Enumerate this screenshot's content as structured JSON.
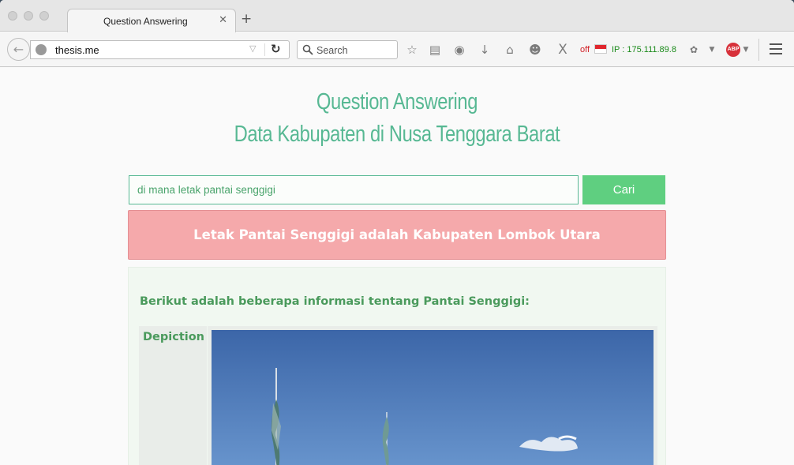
{
  "browser": {
    "tab_title": "Question Answering",
    "tab_close": "✕",
    "new_tab": "+",
    "url": "thesis.me",
    "search_placeholder": "Search",
    "ip_status": "off",
    "ip_label": "IP : 175.111.89.8",
    "abp_label": "ABP",
    "icons": [
      "back-arrow-icon",
      "globe-icon",
      "reload-icon",
      "search-icon",
      "star-icon",
      "reader-icon",
      "pocket-icon",
      "download-icon",
      "home-icon",
      "emoji-icon",
      "x-icon",
      "flag-icon",
      "extension-icon",
      "abp-icon",
      "menu-icon"
    ]
  },
  "page": {
    "title_line1": "Question Answering",
    "title_line2": "Data Kabupaten di Nusa Tenggara Barat",
    "query_value": "di mana letak pantai senggigi",
    "search_button": "Cari",
    "answer": "Letak Pantai Senggigi adalah Kabupaten Lombok Utara",
    "info_heading": "Berikut adalah beberapa informasi tentang Pantai Senggigi:",
    "depiction_label": "Depiction"
  },
  "colors": {
    "accent_green": "#57b893",
    "button_green": "#5fcf80",
    "answer_pink": "#f5a9ab",
    "info_green": "#4a9a5c"
  }
}
